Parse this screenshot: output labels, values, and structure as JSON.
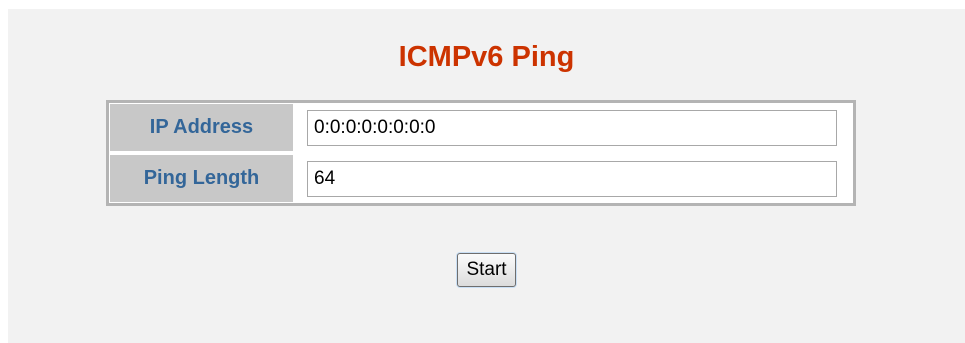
{
  "page": {
    "title": "ICMPv6 Ping"
  },
  "form": {
    "fields": [
      {
        "label": "IP Address",
        "value": "0:0:0:0:0:0:0:0"
      },
      {
        "label": "Ping Length",
        "value": "64"
      }
    ]
  },
  "actions": {
    "start_label": "Start"
  },
  "colors": {
    "title": "#cc3300",
    "label_text": "#336699",
    "label_bg": "#c8c8c8",
    "panel_bg": "#f2f2f2",
    "table_border": "#b4b4b4"
  }
}
